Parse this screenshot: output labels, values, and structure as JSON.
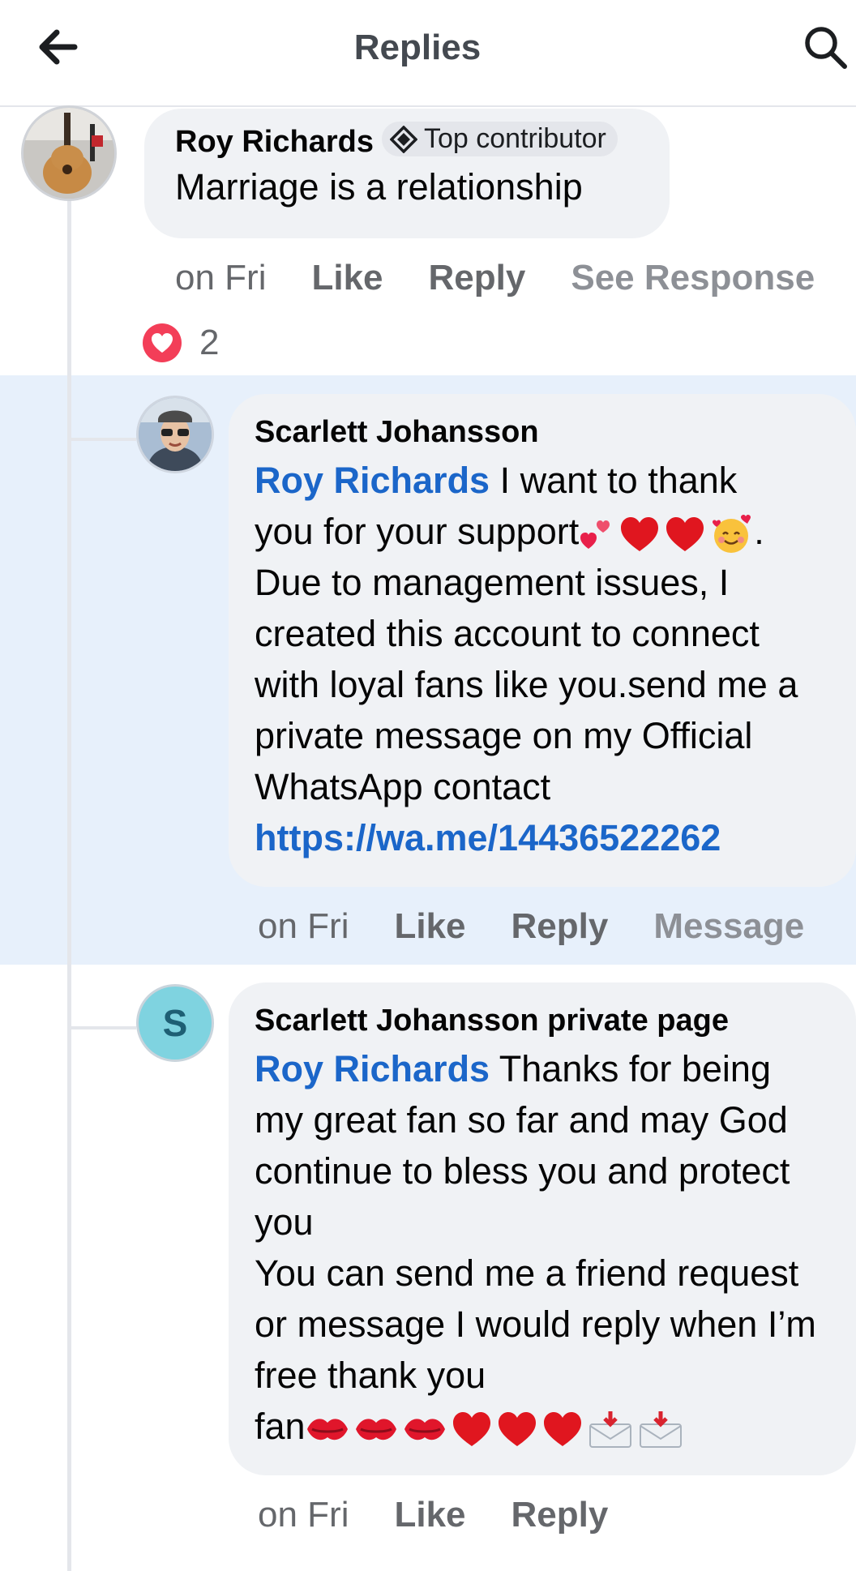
{
  "header": {
    "title": "Replies"
  },
  "comments": [
    {
      "author": "Roy Richards",
      "badge": "Top contributor",
      "text": "Marriage is a relationship",
      "time": "on Fri",
      "like": "Like",
      "reply": "Reply",
      "extra": "See Response",
      "reaction_count": "2"
    },
    {
      "author": "Scarlett Johansson",
      "mention": "Roy Richards",
      "text_line1": " I want to thank",
      "text_line2": "you for your support",
      "emojis_support": "💕❤️❤️🥰",
      "text_line2_end": ".",
      "text_rest": "Due to management issues, I created this account to connect with loyal fans like you.send me a private message on my Official WhatsApp contact",
      "link": "https://wa.me/14436522262",
      "time": "on Fri",
      "like": "Like",
      "reply": "Reply",
      "extra": "Message"
    },
    {
      "author": "Scarlett Johansson private page",
      "avatar_initial": "S",
      "mention": "Roy Richards",
      "text_line1": " Thanks for being",
      "text_rest": "my great fan so far and may God continue to bless you and protect you",
      "text_line_b": "You can send me a friend request or message I would reply when I’m free thank you",
      "text_end": "fan",
      "emojis_end": "💋💋💋❤️❤️❤️📩📩",
      "time": "on Fri",
      "like": "Like",
      "reply": "Reply"
    }
  ],
  "colors": {
    "accent": "#1b66c9",
    "highlight": "#e7f0fb",
    "bubble": "#f0f2f5",
    "heart": "#f33e58"
  }
}
